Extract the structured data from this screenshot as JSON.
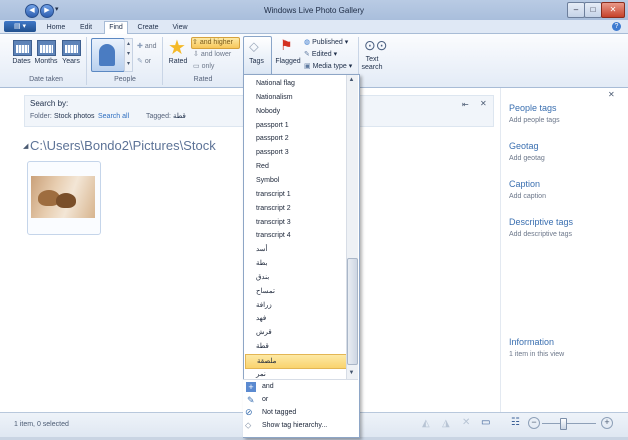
{
  "window": {
    "title": "Windows Live Photo Gallery",
    "minimize": "–",
    "maximize": "□",
    "close": "✕",
    "quick_access": [
      "◀",
      "▶",
      "▾"
    ]
  },
  "ribbon_tabs": [
    "Home",
    "Edit",
    "Find",
    "Create",
    "View"
  ],
  "help": "?",
  "ribbon": {
    "dates": "Dates",
    "months": "Months",
    "years": "Years",
    "date_taken_group": "Date taken",
    "people_group": "People",
    "and": "and",
    "or": "or",
    "rated": "Rated",
    "and_higher": "and higher",
    "and_lower": "and lower",
    "only": "only",
    "rated_group": "Rated",
    "tags": "Tags",
    "flagged": "Flagged",
    "published": "Published",
    "edited": "Edited",
    "media_type": "Media type",
    "text_search_1": "Text",
    "text_search_2": "search"
  },
  "search_panel": {
    "title": "Search by:",
    "folder_label": "Folder:",
    "folder_value": "Stock photos",
    "search_all": "Search all",
    "tagged_label": "Tagged:",
    "tagged_value": "قطة"
  },
  "path": "C:\\Users\\Bondo2\\Pictures\\Stock",
  "right_panel": {
    "people_tags": "People tags",
    "add_people_tags": "Add people tags",
    "geotag": "Geotag",
    "add_geotag": "Add geotag",
    "caption": "Caption",
    "add_caption": "Add caption",
    "descriptive_tags": "Descriptive tags",
    "add_descriptive_tags": "Add descriptive tags",
    "information": "Information",
    "items_in_view": "1 item in this view"
  },
  "status": {
    "text": "1 item, 0 selected"
  },
  "tag_dropdown": {
    "items": [
      "National flag",
      "Nationalism",
      "Nobody",
      "passport 1",
      "passport 2",
      "passport 3",
      "Red",
      "Symbol",
      "transcript 1",
      "transcript 2",
      "transcript 3",
      "transcript 4",
      "أسد",
      "بطة",
      "بندق",
      "تمساح",
      "زرافة",
      "فهد",
      "قرش",
      "قطة",
      "ملصقة",
      "نمر"
    ],
    "highlighted_index": 20,
    "and": "and",
    "or": "or",
    "not_tagged": "Not tagged",
    "show_hierarchy": "Show tag hierarchy..."
  }
}
